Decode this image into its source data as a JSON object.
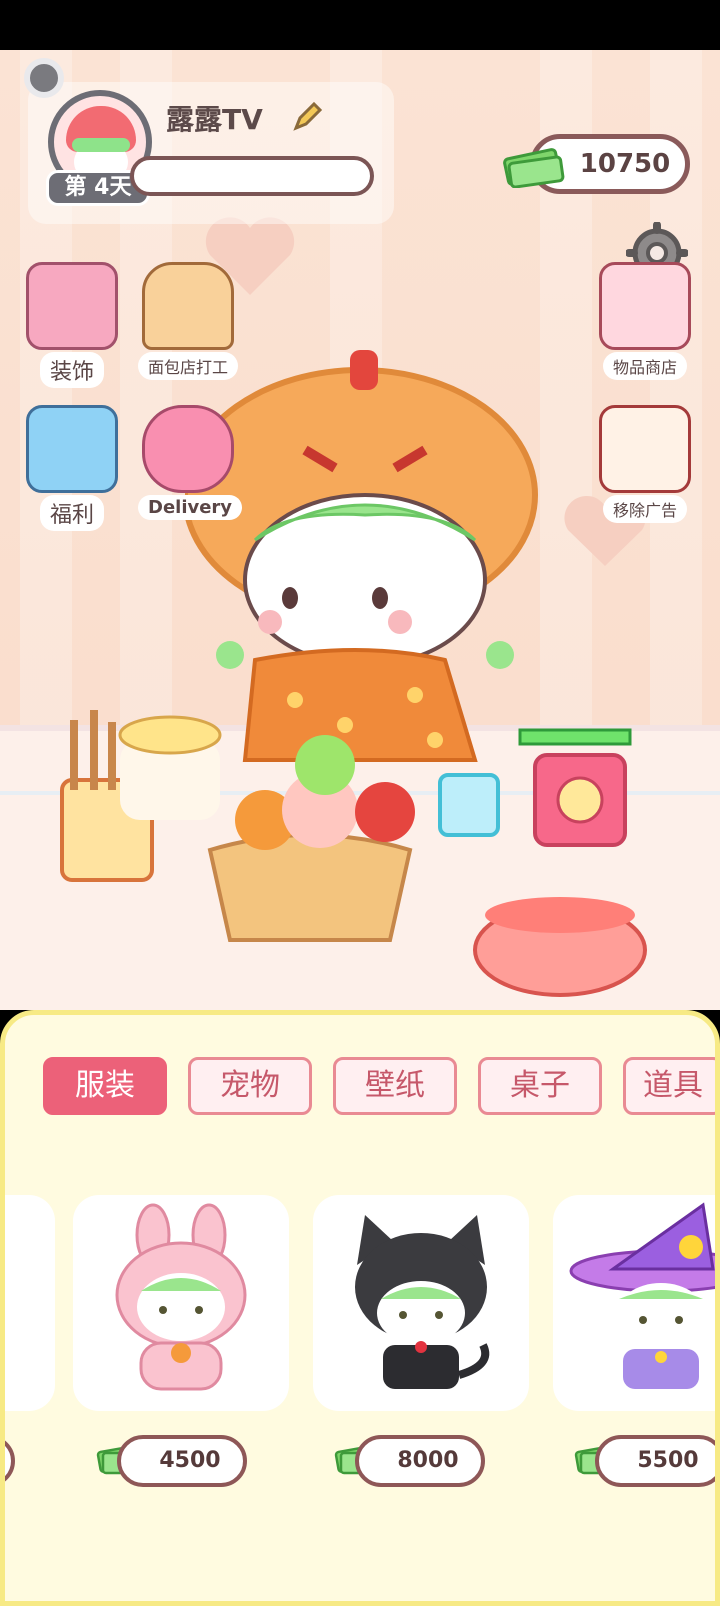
{
  "profile": {
    "name": "露露TV",
    "day_label": "第 4天"
  },
  "currency": {
    "amount": "10750"
  },
  "menu_left": [
    {
      "label": "装饰"
    },
    {
      "label": "面包店打工"
    },
    {
      "label": "福利"
    },
    {
      "label": "Delivery"
    }
  ],
  "menu_right": [
    {
      "label": "物品商店"
    },
    {
      "label": "移除广告"
    }
  ],
  "shop": {
    "tabs": [
      {
        "label": "服装",
        "active": true
      },
      {
        "label": "宠物",
        "active": false
      },
      {
        "label": "壁纸",
        "active": false
      },
      {
        "label": "桌子",
        "active": false
      },
      {
        "label": "道具",
        "active": false
      }
    ],
    "items": [
      {
        "outfit": "pink-bunny",
        "price": "4500"
      },
      {
        "outfit": "black-cat",
        "price": "8000"
      },
      {
        "outfit": "purple-witch",
        "price": "5500"
      }
    ]
  },
  "colors": {
    "accent": "#ec6179",
    "panel_bg": "#fffbe0",
    "panel_border": "#f7ea85"
  }
}
